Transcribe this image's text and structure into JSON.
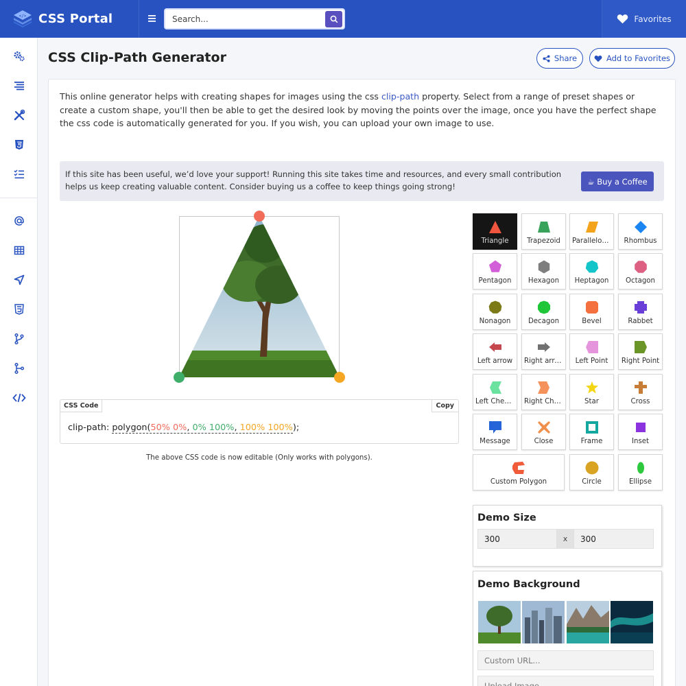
{
  "header": {
    "logo_text": "CSS Portal",
    "search_placeholder": "Search...",
    "favorites_label": "Favorites"
  },
  "sidebar": {
    "items": [
      "settings-gears",
      "align-lines",
      "tools",
      "html5",
      "checklist",
      "at-sign",
      "table",
      "send",
      "css3",
      "git-branch",
      "git-merge",
      "code"
    ]
  },
  "page": {
    "title": "CSS Clip-Path Generator",
    "share_label": "Share",
    "add_favorites_label": "Add to Favorites",
    "intro_before_link": "This online generator helps with creating shapes for images using the css ",
    "intro_link": "clip-path",
    "intro_after_link": " property. Select from a range of preset shapes or create a custom shape, you'll then be able to get the desired look by moving the points over the image, once you have the perfect shape the css code is automatically generated for you. If you wish, you can upload your own image to use.",
    "support_text": "If this site has been useful, we’d love your support! Running this site takes time and resources, and every small contribution helps us keep creating valuable content. Consider buying us a coffee to keep things going strong!",
    "coffee_label": "☕ Buy a Coffee"
  },
  "code": {
    "tab_label": "CSS Code",
    "copy_label": "Copy",
    "prop": "clip-path: ",
    "fn": "polygon",
    "p1": "50% 0%",
    "p2": "0% 100%",
    "p3": "100% 100%",
    "end": ");",
    "note": "The above CSS code is now editable (Only works with polygons)."
  },
  "shapes": [
    {
      "label": "Triangle",
      "color": "#f0553f",
      "active": true
    },
    {
      "label": "Trapezoid",
      "color": "#3aa35b"
    },
    {
      "label": "Parallelogram",
      "color": "#f4a41c"
    },
    {
      "label": "Rhombus",
      "color": "#1b86f2"
    },
    {
      "label": "Pentagon",
      "color": "#d35fd8"
    },
    {
      "label": "Hexagon",
      "color": "#7e7e7e"
    },
    {
      "label": "Heptagon",
      "color": "#13c5c9"
    },
    {
      "label": "Octagon",
      "color": "#dd5f82"
    },
    {
      "label": "Nonagon",
      "color": "#7c7a16"
    },
    {
      "label": "Decagon",
      "color": "#1ec638"
    },
    {
      "label": "Bevel",
      "color": "#f4713f"
    },
    {
      "label": "Rabbet",
      "color": "#6a3fd8"
    },
    {
      "label": "Left arrow",
      "color": "#c4474e"
    },
    {
      "label": "Right arrow",
      "color": "#717171"
    },
    {
      "label": "Left Point",
      "color": "#e595db"
    },
    {
      "label": "Right Point",
      "color": "#6b9527"
    },
    {
      "label": "Left Chevron",
      "color": "#6be2a0"
    },
    {
      "label": "Right Chevron",
      "color": "#f5925c"
    },
    {
      "label": "Star",
      "color": "#f4d512"
    },
    {
      "label": "Cross",
      "color": "#c77d35"
    },
    {
      "label": "Message",
      "color": "#2563d8"
    },
    {
      "label": "Close",
      "color": "#f1904d"
    },
    {
      "label": "Frame",
      "color": "#14a8a0"
    },
    {
      "label": "Inset",
      "color": "#8a33df"
    },
    {
      "label": "Custom Polygon",
      "color": "#f25b3a"
    },
    {
      "label": "Circle",
      "color": "#d9a424"
    },
    {
      "label": "Ellipse",
      "color": "#2ec83f"
    }
  ],
  "demo_size": {
    "title": "Demo Size",
    "width": "300",
    "separator": "x",
    "height": "300"
  },
  "demo_background": {
    "title": "Demo Background",
    "thumbnails": [
      "tree-field",
      "city-skyline",
      "mountain-lake",
      "aurora-night"
    ],
    "custom_url_placeholder": "Custom URL...",
    "upload_placeholder": "Upload Image"
  },
  "colors": {
    "brand": "#2752c0",
    "point1": "#f26c5a",
    "point2": "#3fae6a",
    "point3": "#f5a623"
  }
}
